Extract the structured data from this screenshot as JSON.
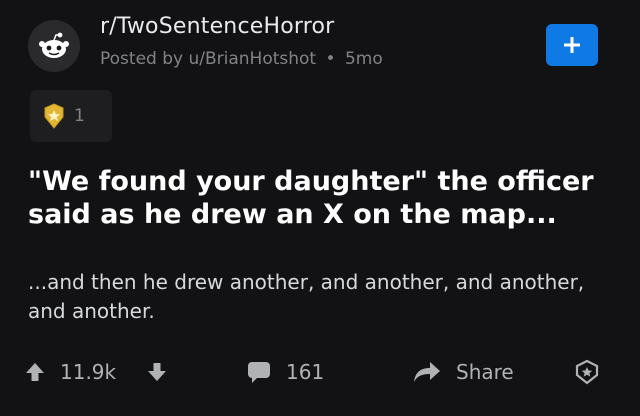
{
  "post": {
    "subreddit": "r/TwoSentenceHorror",
    "posted_prefix": "Posted by",
    "author": "u/BrianHotshot",
    "separator": "•",
    "age": "5mo",
    "award_count": "1",
    "title": "\"We found your daughter\" the officer said as he drew an X on the map...",
    "body": "...and then he drew another, and another, and another, and another."
  },
  "actions": {
    "score": "11.9k",
    "comments": "161",
    "share_label": "Share"
  },
  "icons": {
    "avatar": "snoo-avatar-icon",
    "join": "plus-icon",
    "award": "award-medal-icon",
    "upvote": "upvote-arrow-icon",
    "downvote": "downvote-arrow-icon",
    "comment": "comment-bubble-icon",
    "share": "share-arrow-icon",
    "save": "award-outline-icon"
  },
  "colors": {
    "background": "#121214",
    "accent": "#0f7ae5",
    "muted": "#818384",
    "award_gold": "#e2b532"
  }
}
